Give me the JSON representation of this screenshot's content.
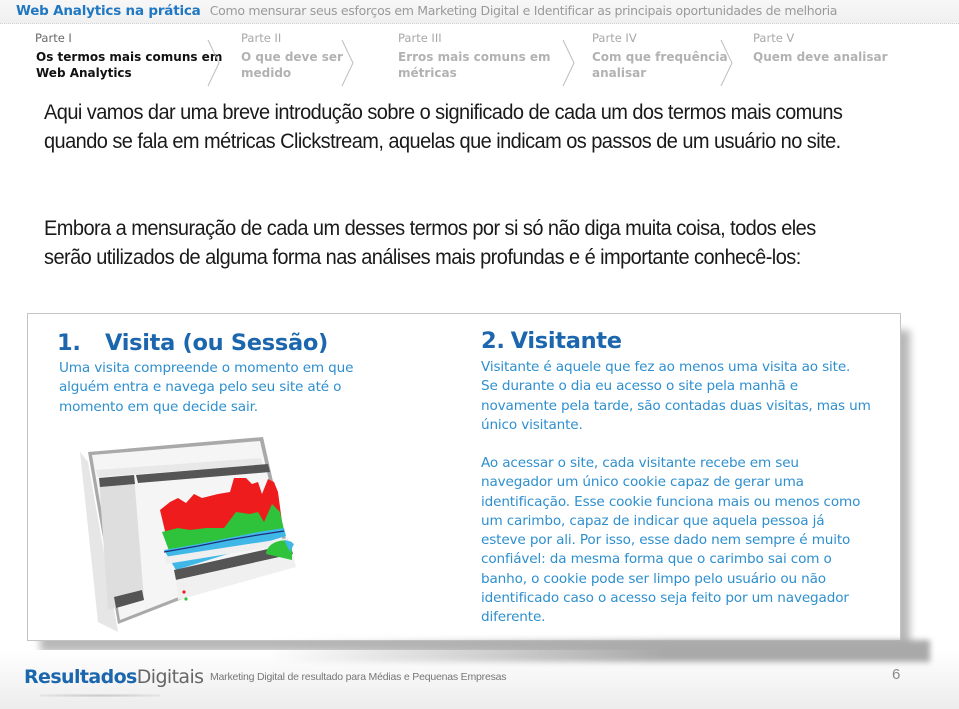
{
  "header": {
    "title": "Web Analytics na prática",
    "subtitle": "Como mensurar seus esforços em Marketing Digital e Identificar as principais oportunidades de melhoria"
  },
  "parts": [
    {
      "label": "Parte I",
      "title_line1": "Os termos mais comuns em",
      "title_line2": "Web Analytics",
      "active": true
    },
    {
      "label": "Parte II",
      "title_line1": "O que deve ser",
      "title_line2": "medido",
      "active": false
    },
    {
      "label": "Parte III",
      "title_line1": "Erros mais comuns em",
      "title_line2": "métricas",
      "active": false
    },
    {
      "label": "Parte IV",
      "title_line1": "Com que frequência",
      "title_line2": "analisar",
      "active": false
    },
    {
      "label": "Parte V",
      "title_line1": "Quem deve analisar",
      "title_line2": "",
      "active": false
    }
  ],
  "intro": {
    "paragraph1": "Aqui vamos dar uma breve introdução sobre o significado de cada um dos termos mais comuns quando se fala em métricas Clickstream, aquelas que indicam os passos de um usuário no site.",
    "paragraph2": "Embora a mensuração de cada um desses termos por si só não diga muita coisa, todos eles serão utilizados de alguma forma nas análises mais profundas e é importante conhecê-los:"
  },
  "sections": [
    {
      "number": "1.",
      "title": "Visita (ou Sessão)",
      "text": "Uma visita compreende o momento em que alguém entra e navega pelo seu site até o momento em que decide sair."
    },
    {
      "number": "2.",
      "title": "Visitante",
      "text": "Visitante é aquele que fez ao menos uma visita ao site. Se durante o dia eu acesso o site pela manhã e novamente pela tarde, são contadas duas visitas, mas um único visitante.",
      "text2": "Ao acessar o site, cada visitante recebe em seu navegador um único cookie capaz de gerar uma identificação. Esse cookie funciona mais ou menos como um carimbo, capaz de indicar que aquela pessoa já esteve por ali. Por isso, esse dado nem sempre é muito confiável: da mesma forma que o carimbo sai com o banho, o cookie pode ser limpo pelo usuário ou não identificado caso o acesso seja feito por um navegador diferente."
    }
  ],
  "illustration": {
    "description": "analytics-dashboard-screenshot",
    "series_colors": {
      "red": "#ee1c1c",
      "green": "#2ec33a",
      "cyan": "#3fb8e8",
      "navy": "#1d2f7a"
    }
  },
  "footer": {
    "brand_bold": "Resultados",
    "brand_light": "Digitais",
    "tagline": "Marketing Digital de resultado para Médias e Pequenas Empresas",
    "page_number": "6"
  },
  "colors": {
    "brand_blue": "#1b66ad",
    "text_blue": "#2e8fcf",
    "title_blue": "#1f78c1"
  }
}
